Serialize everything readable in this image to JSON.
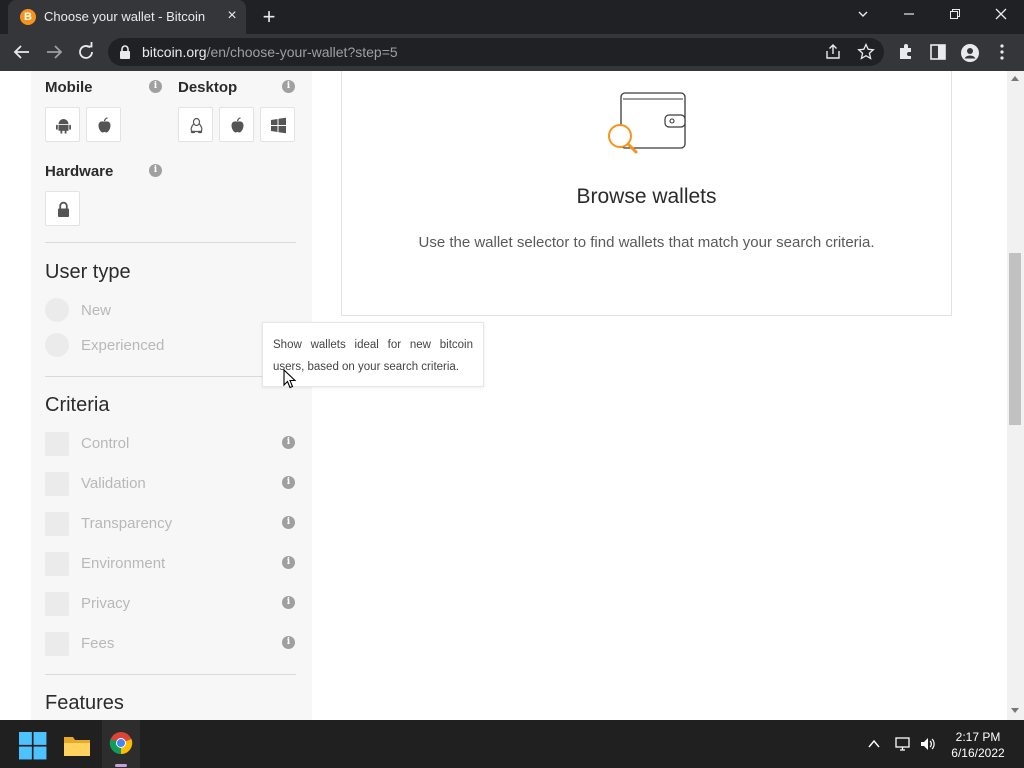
{
  "browser": {
    "tab_title": "Choose your wallet - Bitcoin",
    "favicon_letter": "B",
    "url_domain": "bitcoin.org",
    "url_path": "/en/choose-your-wallet?step=5"
  },
  "sidebar": {
    "mobile_label": "Mobile",
    "desktop_label": "Desktop",
    "hardware_label": "Hardware",
    "info_glyph": "i",
    "user_type": {
      "heading": "User type",
      "options": [
        "New",
        "Experienced"
      ]
    },
    "criteria": {
      "heading": "Criteria",
      "options": [
        "Control",
        "Validation",
        "Transparency",
        "Environment",
        "Privacy",
        "Fees"
      ]
    },
    "features_heading": "Features"
  },
  "main": {
    "card_title": "Browse wallets",
    "card_description": "Use the wallet selector to find wallets that match your search criteria."
  },
  "tooltip": {
    "text": "Show wallets ideal for new bitcoin users, based on your search criteria."
  },
  "taskbar": {
    "time": "2:17 PM",
    "date": "6/16/2022"
  },
  "colors": {
    "bitcoin_orange": "#f7931a",
    "sidebar_bg": "#f7f7f7",
    "chrome_dark": "#202124"
  }
}
